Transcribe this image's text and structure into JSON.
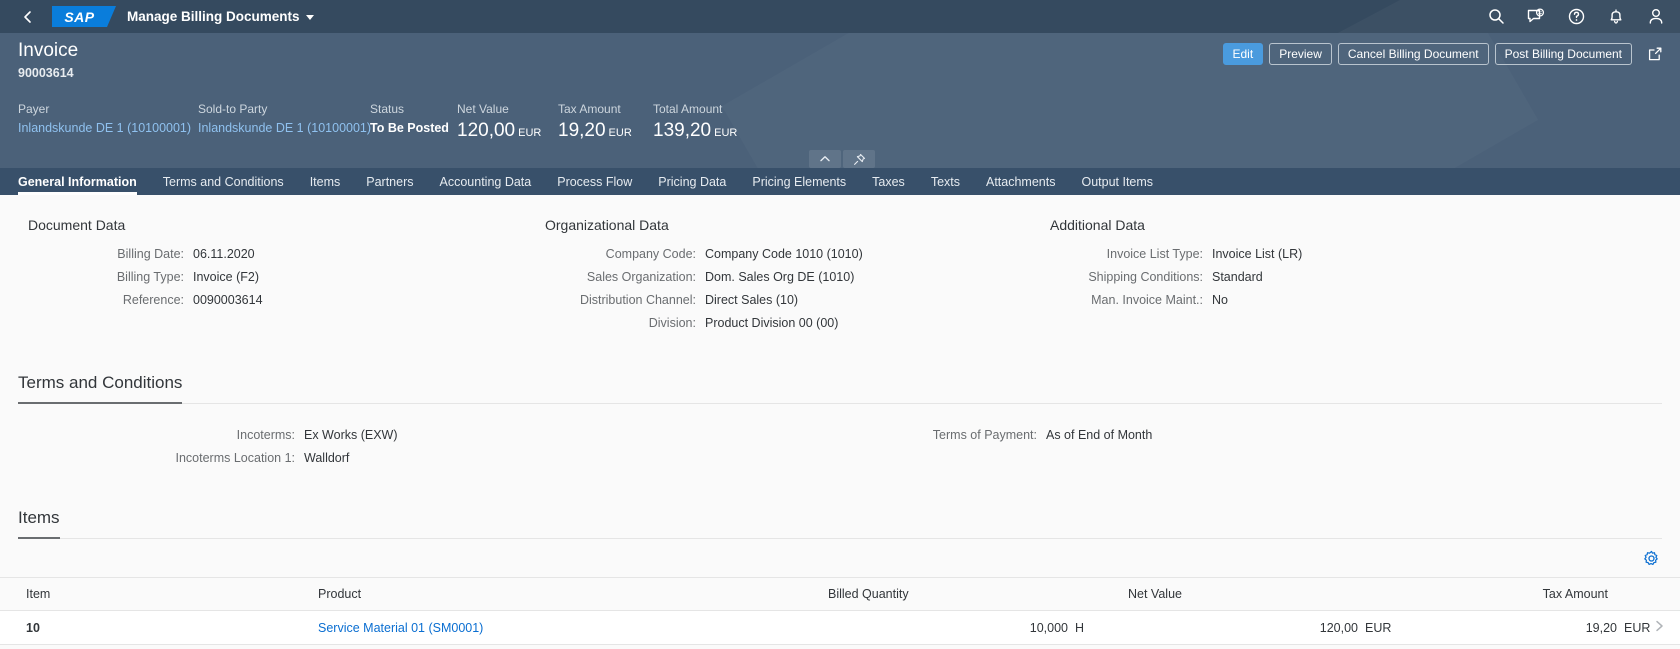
{
  "shell": {
    "back_icon": "back-chevron-icon",
    "logo": "SAP",
    "app_title": "Manage Billing Documents",
    "icons": [
      {
        "name": "search-icon",
        "label": "Search"
      },
      {
        "name": "feedback-icon",
        "label": "Feedback"
      },
      {
        "name": "help-icon",
        "label": "Help"
      },
      {
        "name": "notifications-bell-icon",
        "label": "Notifications"
      },
      {
        "name": "user-avatar-icon",
        "label": "User"
      }
    ]
  },
  "object_header": {
    "title": "Invoice",
    "subtitle": "90003614",
    "actions": {
      "edit": "Edit",
      "preview": "Preview",
      "cancel": "Cancel Billing Document",
      "post": "Post Billing Document",
      "share_icon": "share-icon"
    },
    "facets": [
      {
        "label": "Payer",
        "value": "Inlandskunde DE 1 (10100001)",
        "style": "link"
      },
      {
        "label": "Sold-to Party",
        "value": "Inlandskunde DE 1 (10100001)",
        "style": "link"
      },
      {
        "label": "Status",
        "value": "To Be Posted",
        "style": "bold"
      },
      {
        "label": "Net Value",
        "value": "120,00",
        "unit": "EUR",
        "style": "big"
      },
      {
        "label": "Tax Amount",
        "value": "19,20",
        "unit": "EUR",
        "style": "big"
      },
      {
        "label": "Total Amount",
        "value": "139,20",
        "unit": "EUR",
        "style": "big"
      }
    ],
    "toggles": [
      {
        "name": "collapse-header-icon"
      },
      {
        "name": "pin-header-icon"
      }
    ]
  },
  "tabs": [
    {
      "label": "General Information",
      "selected": true
    },
    {
      "label": "Terms and Conditions",
      "selected": false
    },
    {
      "label": "Items",
      "selected": false
    },
    {
      "label": "Partners",
      "selected": false
    },
    {
      "label": "Accounting Data",
      "selected": false
    },
    {
      "label": "Process Flow",
      "selected": false
    },
    {
      "label": "Pricing Data",
      "selected": false
    },
    {
      "label": "Pricing Elements",
      "selected": false
    },
    {
      "label": "Taxes",
      "selected": false
    },
    {
      "label": "Texts",
      "selected": false
    },
    {
      "label": "Attachments",
      "selected": false
    },
    {
      "label": "Output Items",
      "selected": false
    }
  ],
  "document_data": {
    "title": "Document Data",
    "fields": [
      {
        "label": "Billing Date:",
        "value": "06.11.2020"
      },
      {
        "label": "Billing Type:",
        "value": "Invoice (F2)"
      },
      {
        "label": "Reference:",
        "value": "0090003614"
      }
    ]
  },
  "organizational_data": {
    "title": "Organizational Data",
    "fields": [
      {
        "label": "Company Code:",
        "value": "Company Code 1010 (1010)"
      },
      {
        "label": "Sales Organization:",
        "value": "Dom. Sales Org DE (1010)"
      },
      {
        "label": "Distribution Channel:",
        "value": "Direct Sales (10)"
      },
      {
        "label": "Division:",
        "value": "Product Division 00 (00)"
      }
    ]
  },
  "additional_data": {
    "title": "Additional Data",
    "fields": [
      {
        "label": "Invoice List Type:",
        "value": "Invoice List (LR)"
      },
      {
        "label": "Shipping Conditions:",
        "value": "Standard"
      },
      {
        "label": "Man. Invoice Maint.:",
        "value": "No"
      }
    ]
  },
  "terms_section": {
    "title": "Terms and Conditions",
    "left_fields": [
      {
        "label": "Incoterms:",
        "value": "Ex Works (EXW)"
      },
      {
        "label": "Incoterms Location 1:",
        "value": "Walldorf"
      }
    ],
    "right_fields": [
      {
        "label": "Terms of Payment:",
        "value": "As of End of Month"
      }
    ]
  },
  "items_section": {
    "title": "Items",
    "settings_icon": "gear-icon",
    "columns": [
      "Item",
      "Product",
      "Billed Quantity",
      "Net Value",
      "Tax Amount"
    ],
    "rows": [
      {
        "item": "10",
        "product": "Service Material 01 (SM0001)",
        "billed_quantity": "10,000",
        "billed_quantity_unit": "H",
        "net_value": "120,00",
        "net_value_unit": "EUR",
        "tax_amount": "19,20",
        "tax_amount_unit": "EUR",
        "nav_icon": "row-navigation-chevron-icon"
      }
    ]
  },
  "colors": {
    "shellbar": "#354a5f",
    "header": "#4b6179",
    "tabbar": "#38506a",
    "accent": "#0a6ed1",
    "emphasized_button": "#4a9bde",
    "link_on_dark": "#8fc1ef",
    "content_bg": "#fafafa"
  }
}
